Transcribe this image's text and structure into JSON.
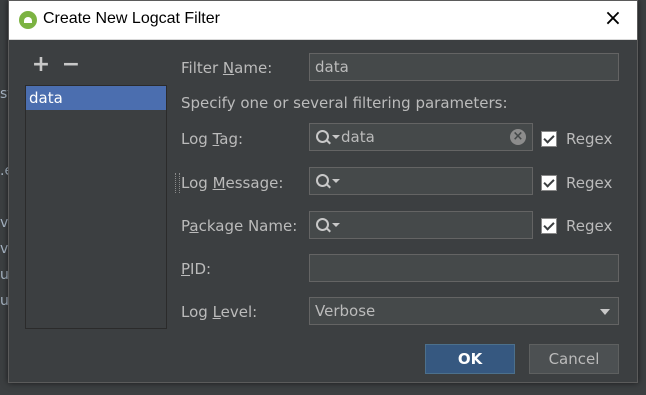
{
  "window": {
    "title": "Create New Logcat Filter",
    "close_icon": "close-icon"
  },
  "list": {
    "add_label": "+",
    "remove_label": "−",
    "items": [
      {
        "label": "data"
      }
    ]
  },
  "form": {
    "filter_name": {
      "label_pre": "Filter ",
      "label_mnemonic": "N",
      "label_post": "ame:",
      "value": "data"
    },
    "hint": "Specify one or several filtering parameters:",
    "log_tag": {
      "label_pre": "Log ",
      "label_mnemonic": "T",
      "label_post": "ag:",
      "value": "data",
      "regex_label": "Regex",
      "regex_checked": true
    },
    "log_message": {
      "label_pre": "Log ",
      "label_mnemonic": "M",
      "label_post": "essage:",
      "value": "",
      "regex_label": "Regex",
      "regex_checked": true
    },
    "package_name": {
      "label_pre": "P",
      "label_mnemonic": "a",
      "label_post": "ckage Name:",
      "value": "",
      "regex_label": "Regex",
      "regex_checked": true
    },
    "pid": {
      "label_pre": "",
      "label_mnemonic": "P",
      "label_post": "ID:",
      "value": ""
    },
    "log_level": {
      "label_pre": "Log ",
      "label_mnemonic": "L",
      "label_post": "evel:",
      "value": "Verbose"
    }
  },
  "buttons": {
    "ok": "OK",
    "cancel": "Cancel"
  },
  "colors": {
    "selection": "#4b6eaf",
    "ok_button": "#365880",
    "dialog_bg": "#3c3f41"
  }
}
